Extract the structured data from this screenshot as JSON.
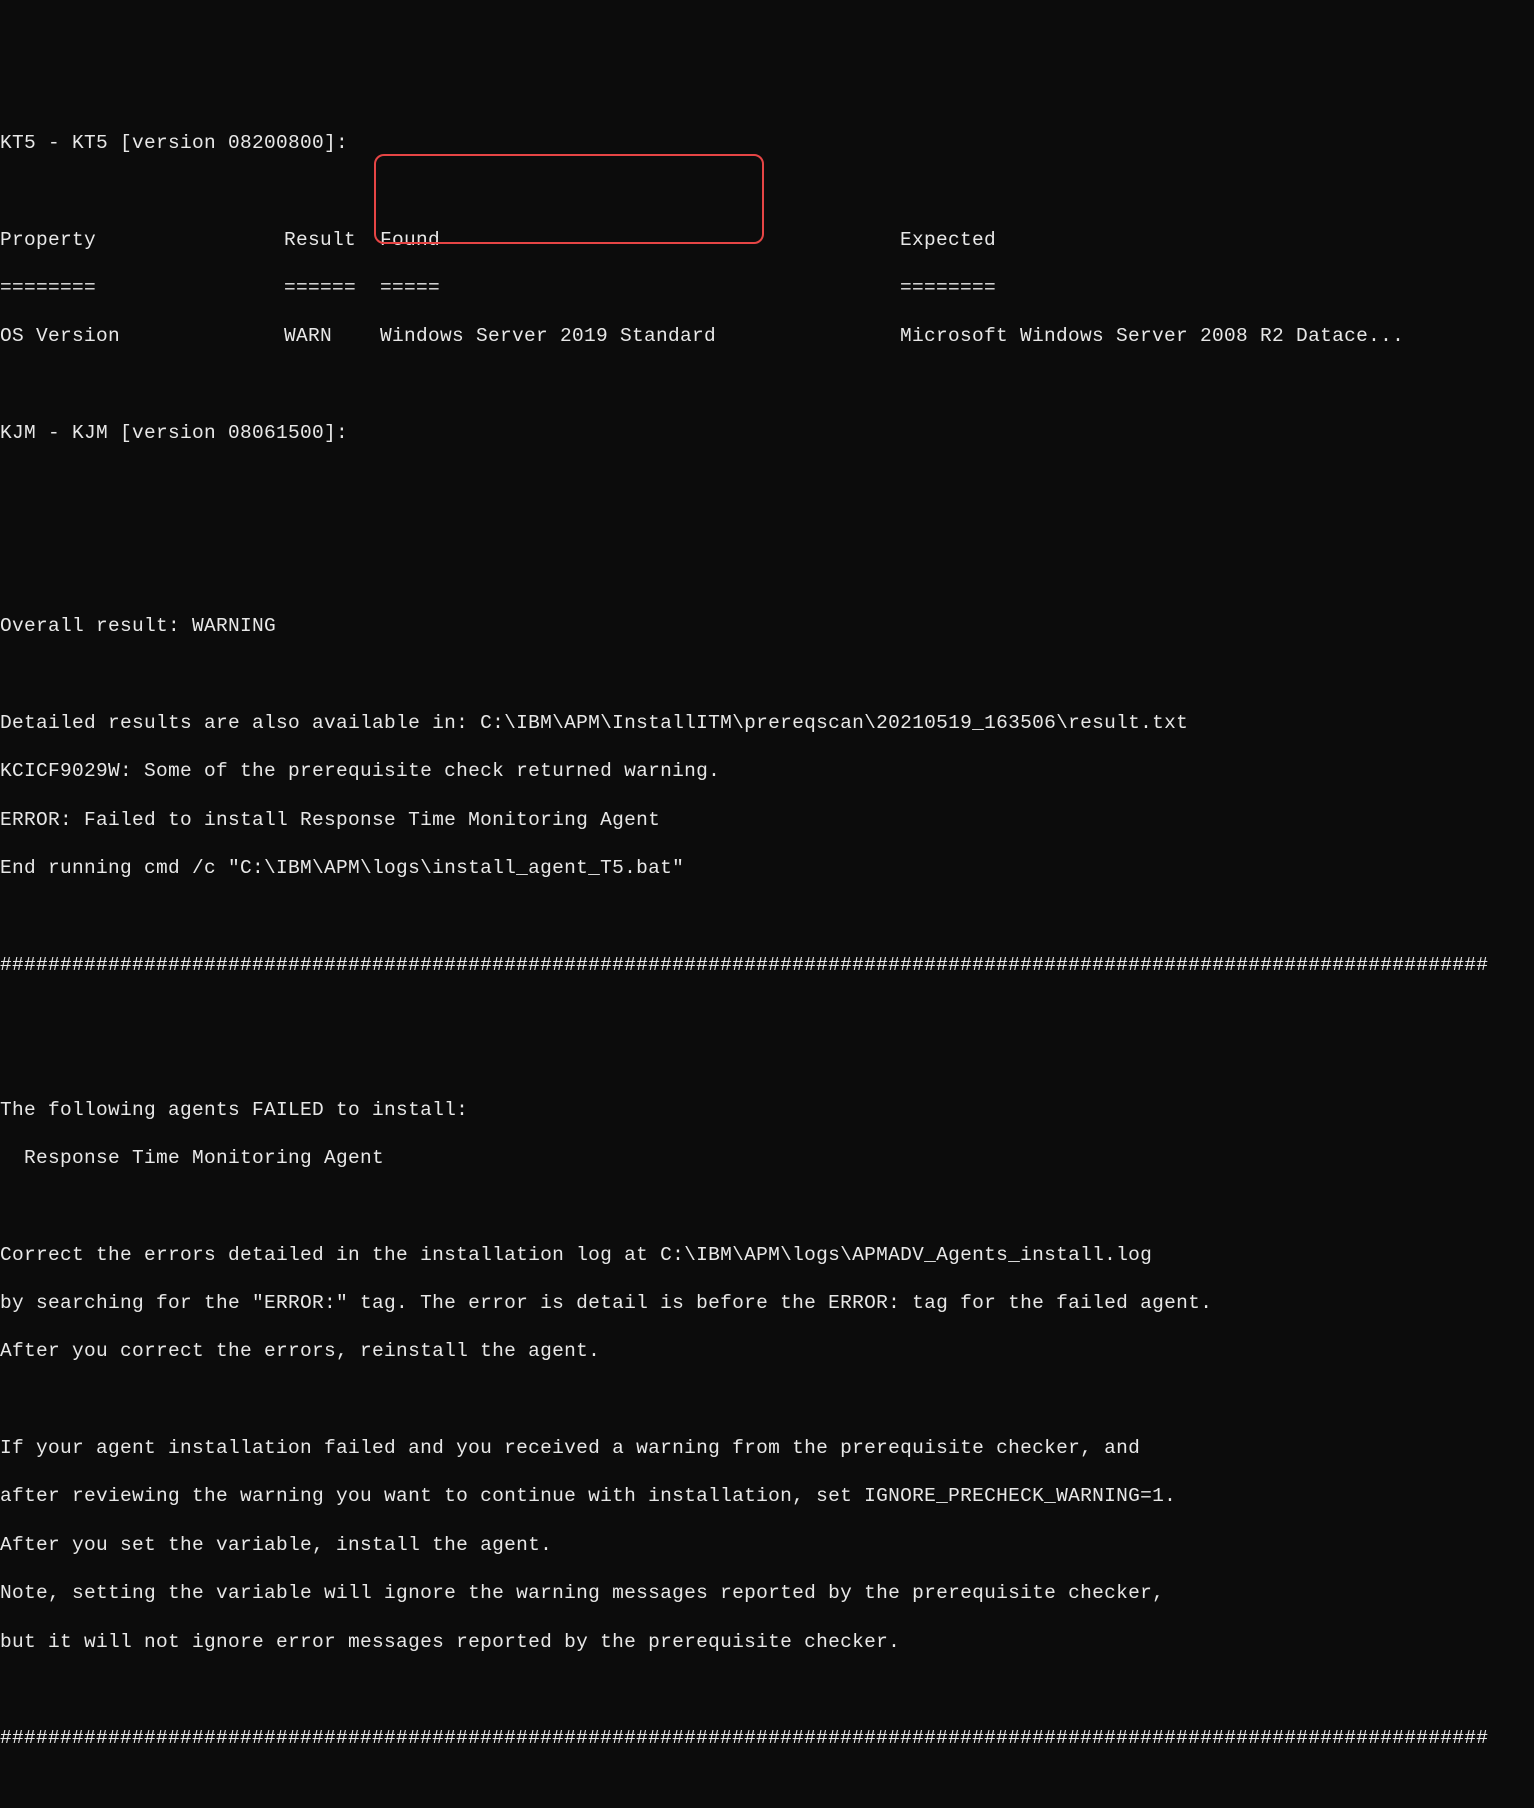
{
  "header_kt5": "KT5 - KT5 [version 08200800]:",
  "table": {
    "headers": {
      "property": "Property",
      "result": "Result",
      "found": "Found",
      "expected": "Expected"
    },
    "separators": {
      "property": "========",
      "result": "======",
      "found": "=====",
      "expected": "========"
    },
    "row": {
      "property": "OS Version",
      "result": "WARN",
      "found": "Windows Server 2019 Standard",
      "expected": "Microsoft Windows Server 2008 R2 Datace..."
    }
  },
  "header_kjm": "KJM - KJM [version 08061500]:",
  "overall_result": "Overall result: WARNING",
  "detailed_line": "Detailed results are also available in: C:\\IBM\\APM\\InstallITM\\prereqscan\\20210519_163506\\result.txt",
  "kcicf_line": "KCICF9029W: Some of the prerequisite check returned warning.",
  "error_line": "ERROR: Failed to install Response Time Monitoring Agent",
  "end_running": "End running cmd /c \"C:\\IBM\\APM\\logs\\install_agent_T5.bat\"",
  "hashes": "############################################################################################################################",
  "failed_header": "The following agents FAILED to install:",
  "failed_agent": "  Response Time Monitoring Agent",
  "correct1": "Correct the errors detailed in the installation log at C:\\IBM\\APM\\logs\\APMADV_Agents_install.log",
  "correct2": "by searching for the \"ERROR:\" tag. The error is detail is before the ERROR: tag for the failed agent.",
  "correct3": "After you correct the errors, reinstall the agent.",
  "ifagent1": "If your agent installation failed and you received a warning from the prerequisite checker, and",
  "ifagent2": "after reviewing the warning you want to continue with installation, set IGNORE_PRECHECK_WARNING=1.",
  "ifagent3": "After you set the variable, install the agent.",
  "note1": "Note, setting the variable will ignore the warning messages reported by the prerequisite checker,",
  "note2": "but it will not ignore error messages reported by the prerequisite checker."
}
